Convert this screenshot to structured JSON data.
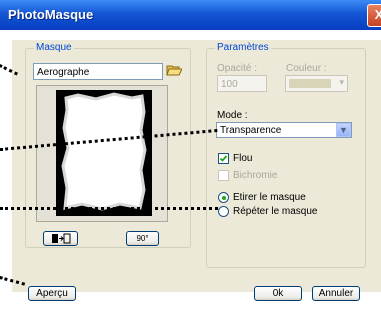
{
  "window": {
    "title": "PhotoMasque",
    "close_glyph": "X"
  },
  "masque": {
    "legend": "Masque",
    "file_value": "Aerographe",
    "folder_icon": "open-folder-icon"
  },
  "parametres": {
    "legend": "Paramètres",
    "opacite_label": "Opacité :",
    "opacite_value": "100",
    "couleur_label": "Couleur :",
    "mode_label": "Mode :",
    "mode_value": "Transparence",
    "flou_label": "Flou",
    "flou_checked": true,
    "bichromie_label": "Bichromie",
    "bichromie_checked": false,
    "radio_etirer": "Etirer le masque",
    "radio_repeter": "Répéter le masque",
    "selected_option": "Etirer le masque"
  },
  "buttons": {
    "apercu": "Aperçu",
    "ok": "0k",
    "annuler": "Annuler"
  },
  "icons": {
    "flip": "flip-horizontal-icon",
    "rotate": "rotate-90-icon",
    "rotate_text": "90°"
  }
}
